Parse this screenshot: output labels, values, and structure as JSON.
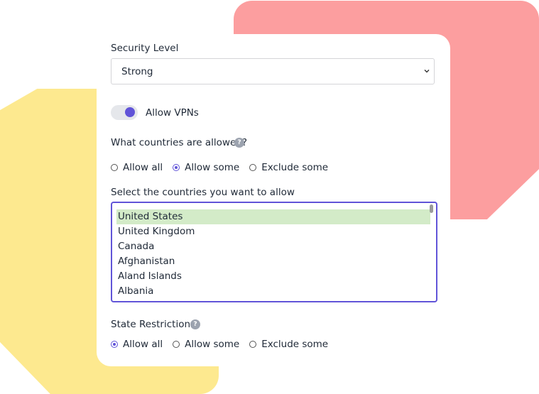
{
  "security": {
    "label": "Security Level",
    "selected": "Strong"
  },
  "vpn": {
    "label": "Allow VPNs",
    "enabled": true
  },
  "countries": {
    "question": "What countries are allowed?",
    "help": "?",
    "options": [
      "Allow all",
      "Allow some",
      "Exclude some"
    ],
    "selected": "Allow some",
    "list_label": "Select the countries you want to allow",
    "items": [
      "United States",
      "United Kingdom",
      "Canada",
      "Afghanistan",
      "Aland Islands",
      "Albania"
    ],
    "selected_items": [
      "United States"
    ]
  },
  "states": {
    "label": "State Restrictions",
    "help": "?",
    "options": [
      "Allow all",
      "Allow some",
      "Exclude some"
    ],
    "selected": "Allow all"
  },
  "colors": {
    "accent": "#6154d8",
    "pink_shape": "#fc9e9f",
    "yellow_shape": "#fde98f",
    "selection": "#d3ebc8"
  }
}
